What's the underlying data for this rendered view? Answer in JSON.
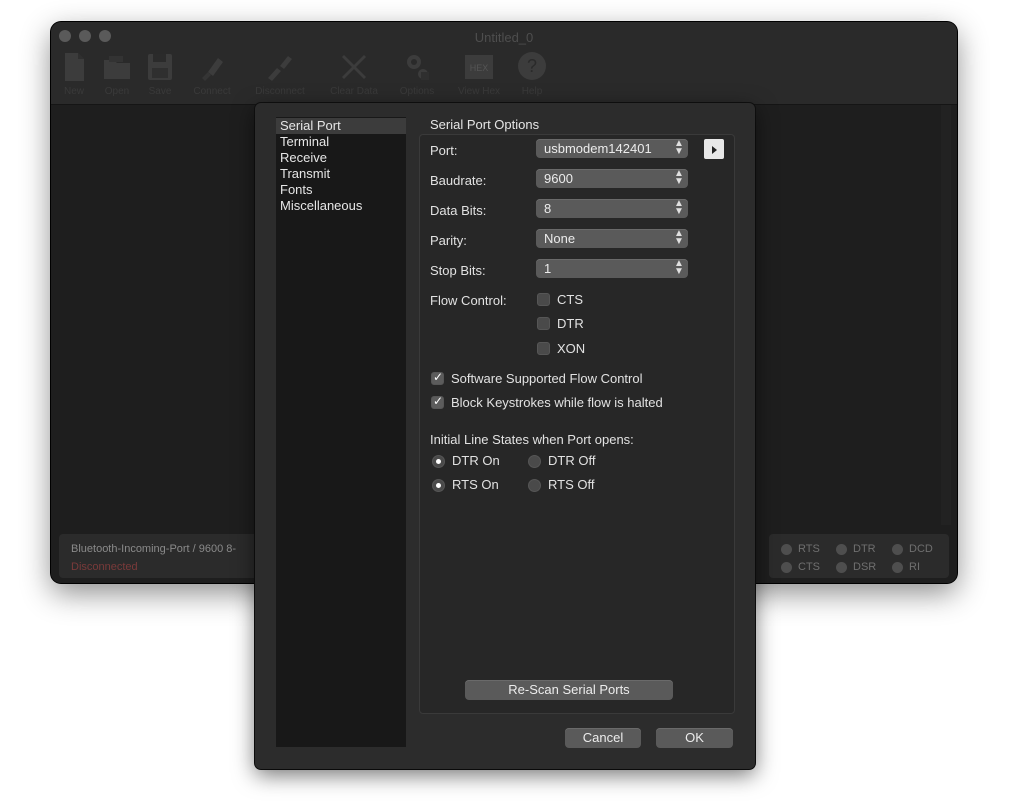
{
  "window": {
    "title": "Untitled_0",
    "toolbar": [
      {
        "label": "New",
        "icon": "new-document-icon"
      },
      {
        "label": "Open",
        "icon": "open-folder-icon"
      },
      {
        "label": "Save",
        "icon": "save-disk-icon"
      },
      {
        "label": "Connect",
        "icon": "connect-plug-icon"
      },
      {
        "label": "Disconnect",
        "icon": "disconnect-plug-icon"
      },
      {
        "label": "Clear Data",
        "icon": "clear-x-icon"
      },
      {
        "label": "Options",
        "icon": "options-gears-icon"
      },
      {
        "label": "View Hex",
        "icon": "hex-icon",
        "icon_text": "HEX"
      },
      {
        "label": "Help",
        "icon": "help-question-icon",
        "icon_text": "?"
      }
    ],
    "status": {
      "port_info": "Bluetooth-Incoming-Port / 9600 8-",
      "connection": "Disconnected",
      "leds": [
        {
          "label": "RTS"
        },
        {
          "label": "DTR"
        },
        {
          "label": "DCD"
        },
        {
          "label": "CTS"
        },
        {
          "label": "DSR"
        },
        {
          "label": "RI"
        }
      ]
    }
  },
  "dialog": {
    "sidebar": [
      "Serial Port",
      "Terminal",
      "Receive",
      "Transmit",
      "Fonts",
      "Miscellaneous"
    ],
    "selected": "Serial Port",
    "group_title": "Serial Port Options",
    "fields": {
      "port": {
        "label": "Port:",
        "value": "usbmodem142401"
      },
      "baudrate": {
        "label": "Baudrate:",
        "value": "9600"
      },
      "data_bits": {
        "label": "Data Bits:",
        "value": "8"
      },
      "parity": {
        "label": "Parity:",
        "value": "None"
      },
      "stop_bits": {
        "label": "Stop Bits:",
        "value": "1"
      }
    },
    "flow_control": {
      "label": "Flow Control:",
      "options": [
        {
          "label": "CTS",
          "checked": false
        },
        {
          "label": "DTR",
          "checked": false
        },
        {
          "label": "XON",
          "checked": false
        }
      ]
    },
    "software_flow": {
      "label": "Software Supported Flow Control",
      "checked": true
    },
    "block_keystrokes": {
      "label": "Block Keystrokes while flow is halted",
      "checked": true
    },
    "line_states": {
      "label": "Initial Line States when Port opens:",
      "dtr_on": "DTR On",
      "dtr_off": "DTR Off",
      "rts_on": "RTS On",
      "rts_off": "RTS Off",
      "dtr_selected": "DTR On",
      "rts_selected": "RTS On"
    },
    "rescan_label": "Re-Scan Serial Ports",
    "cancel_label": "Cancel",
    "ok_label": "OK"
  },
  "colors": {
    "window_bg": "#1e1e1e",
    "sheet_bg": "#2c2c2c",
    "disconnected": "#7a3a3a"
  }
}
